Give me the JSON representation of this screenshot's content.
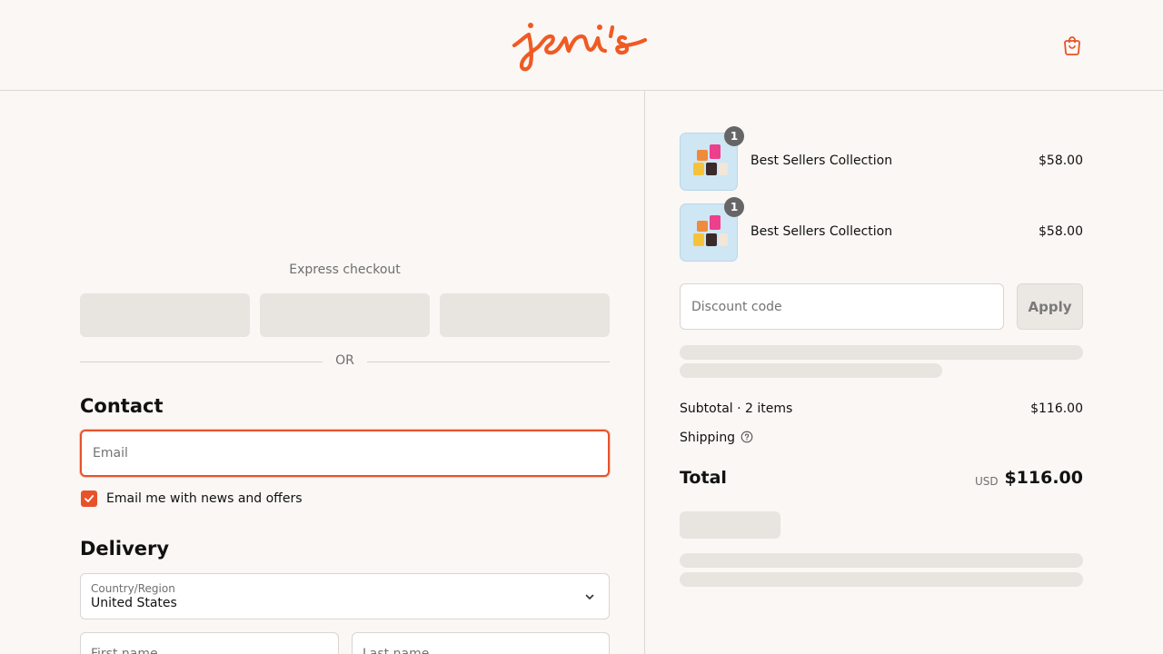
{
  "brand": {
    "name": "jeni's",
    "accent": "#e8522a"
  },
  "header": {
    "cart_icon": "shopping-bag-icon"
  },
  "express": {
    "label": "Express checkout",
    "divider": "OR"
  },
  "contact": {
    "title": "Contact",
    "email_placeholder": "Email",
    "newsletter_label": "Email me with news and offers",
    "newsletter_checked": true
  },
  "delivery": {
    "title": "Delivery",
    "country_label": "Country/Region",
    "country_value": "United States",
    "first_name_placeholder": "First name",
    "last_name_placeholder": "Last name"
  },
  "cart": {
    "items": [
      {
        "name": "Best Sellers Collection",
        "price": "$58.00",
        "quantity": "1"
      },
      {
        "name": "Best Sellers Collection",
        "price": "$58.00",
        "quantity": "1"
      }
    ]
  },
  "discount": {
    "placeholder": "Discount code",
    "apply_label": "Apply"
  },
  "summary": {
    "subtotal_label": "Subtotal · 2 items",
    "subtotal_value": "$116.00",
    "shipping_label": "Shipping",
    "total_label": "Total",
    "currency": "USD",
    "total_value": "$116.00"
  }
}
